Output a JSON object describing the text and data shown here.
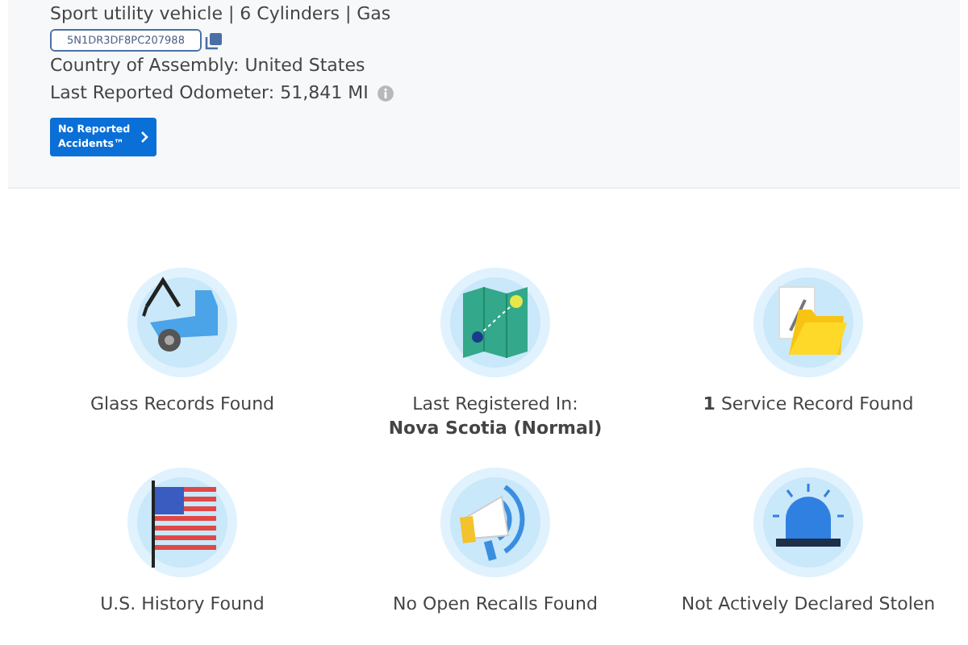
{
  "vehicle": {
    "description": "Sport utility vehicle | 6 Cylinders | Gas",
    "vin": "5N1DR3DF8PC207988",
    "assembly": "Country of Assembly: United States",
    "odometer": "Last Reported Odometer: 51,841 MI",
    "accident_badge": "No Reported Accidents™"
  },
  "highlights": [
    {
      "kind": "tow-truck",
      "label": "Glass Records Found"
    },
    {
      "kind": "map",
      "label": "Last Registered In:",
      "detail": "Nova Scotia (Normal)"
    },
    {
      "kind": "folder",
      "label": "**1** Service Record Found"
    },
    {
      "kind": "flag",
      "label": "U.S. History Found"
    },
    {
      "kind": "megaphone",
      "label": "No Open Recalls Found"
    },
    {
      "kind": "siren",
      "label": "Not Actively Declared Stolen"
    }
  ]
}
